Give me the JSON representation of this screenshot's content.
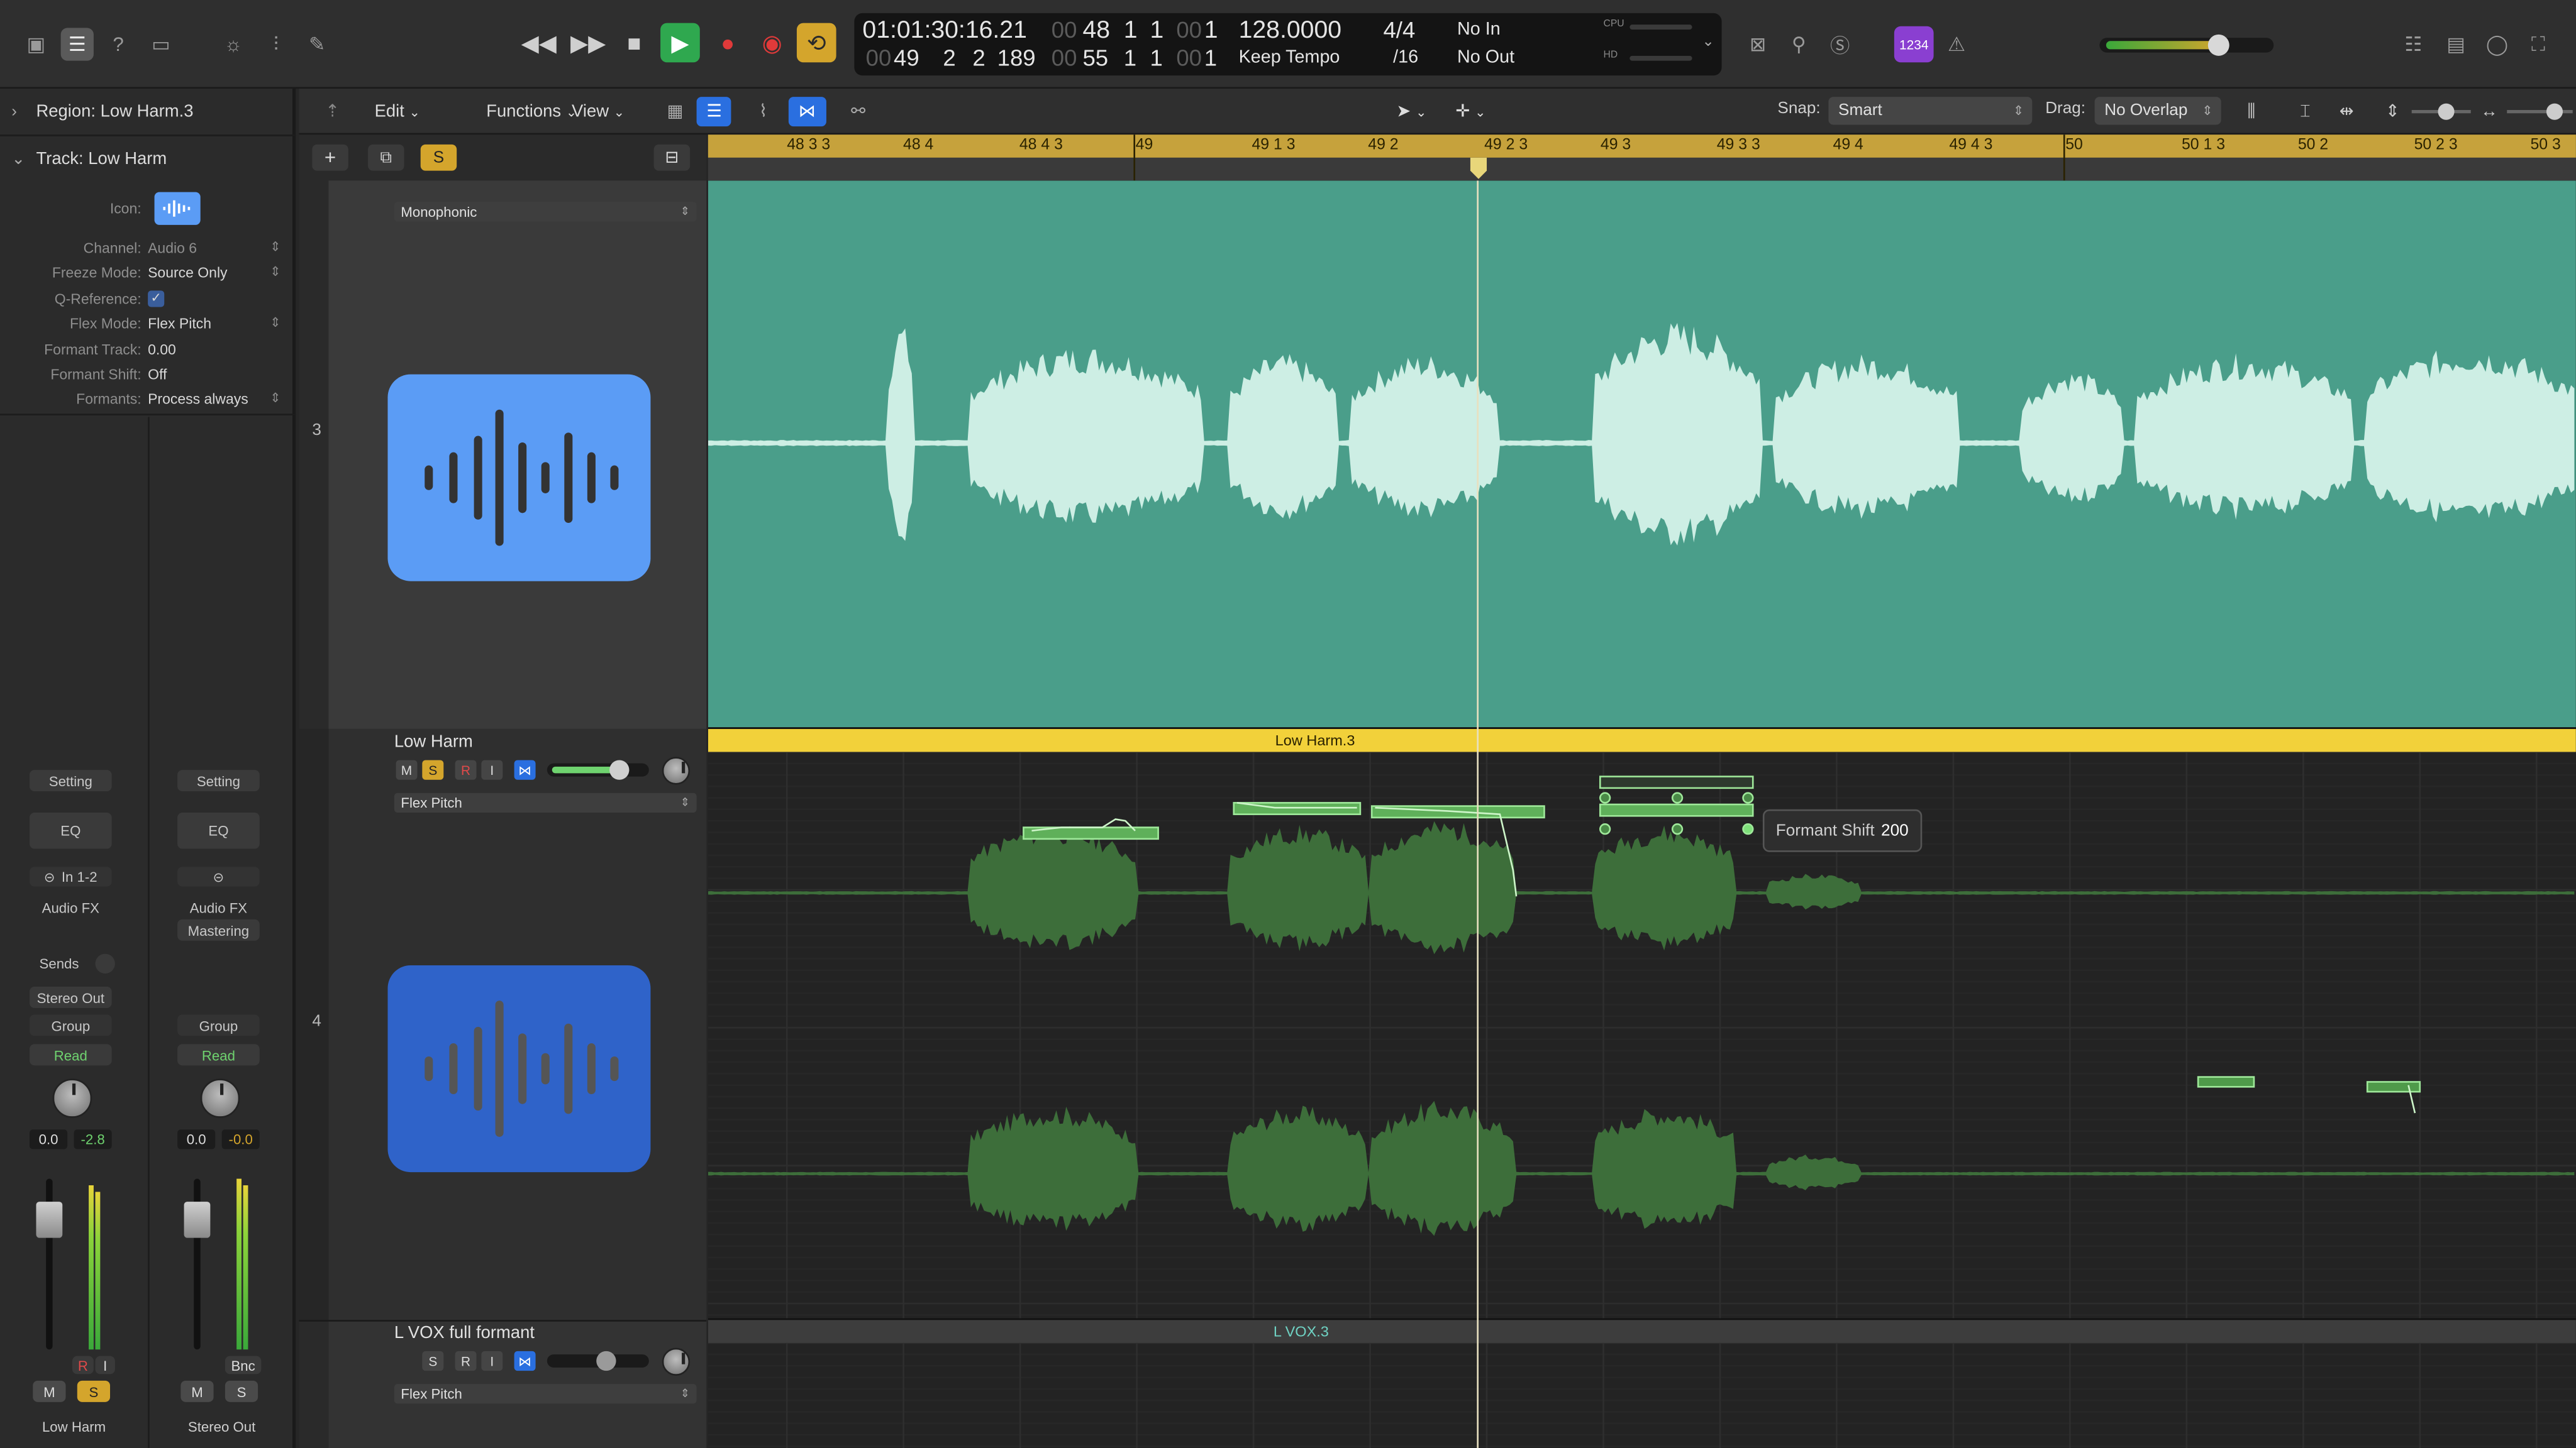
{
  "transport": {
    "time": "01:01:30:16.21",
    "time_dim": "00",
    "bars_top": [
      "48",
      "1",
      "1"
    ],
    "bars_top_dim": "00",
    "bars_top_tick": "1",
    "bars_bottom": [
      "49",
      "2",
      "2",
      "189"
    ],
    "bars_bottom_dim": "00",
    "bars_bottom2": [
      "55",
      "1",
      "1"
    ],
    "bars_bottom2_tick": "1",
    "tempo": "128.0000",
    "tempo_mode": "Keep Tempo",
    "signature": "4/4",
    "division": "/16",
    "in": "No In",
    "out": "No Out",
    "cpu_label": "CPU",
    "hd_label": "HD",
    "badge": "1234"
  },
  "inspector": {
    "region_label": "Region:",
    "region_name": "Low Harm.3",
    "track_label": "Track:",
    "track_name": "Low Harm",
    "icon_label": "Icon:",
    "rows": [
      {
        "label": "Channel:",
        "value": "Audio 6"
      },
      {
        "label": "Freeze Mode:",
        "value": "Source Only"
      },
      {
        "label": "Q-Reference:",
        "value": "✓"
      },
      {
        "label": "Flex Mode:",
        "value": "Flex Pitch"
      },
      {
        "label": "Formant Track:",
        "value": "0.00"
      },
      {
        "label": "Formant Shift:",
        "value": "Off"
      },
      {
        "label": "Formants:",
        "value": "Process always"
      }
    ]
  },
  "strips": [
    {
      "setting": "Setting",
      "eq": "EQ",
      "input": "In 1-2",
      "audiofx": "Audio FX",
      "fx2": "",
      "sends": "Sends",
      "output": "Stereo Out",
      "group": "Group",
      "auto": "Read",
      "vol": "0.0",
      "peak": "-2.8",
      "btn_r": "R",
      "btn_i": "I",
      "m": "M",
      "s": "S",
      "name": "Low Harm"
    },
    {
      "setting": "Setting",
      "eq": "EQ",
      "input": "",
      "audiofx": "Audio FX",
      "fx2": "Mastering",
      "sends": "",
      "output": "",
      "group": "Group",
      "auto": "Read",
      "vol": "0.0",
      "peak": "-0.0",
      "btn_r": "Bnc",
      "btn_i": "",
      "m": "M",
      "s": "S",
      "name": "Stereo Out"
    }
  ],
  "toolbar": {
    "edit": "Edit",
    "functions": "Functions",
    "view": "View",
    "snap_label": "Snap:",
    "snap_value": "Smart",
    "drag_label": "Drag:",
    "drag_value": "No Overlap"
  },
  "ruler": {
    "labels": [
      "48 3 3",
      "48 4",
      "48 4 3",
      "49",
      "49 1 3",
      "49 2",
      "49 2 3",
      "49 3",
      "49 3 3",
      "49 4",
      "49 4 3",
      "50",
      "50 1 3",
      "50 2",
      "50 2 3",
      "50 3"
    ]
  },
  "tracks": [
    {
      "number": "3",
      "name": "",
      "mode": "Monophonic"
    },
    {
      "number": "4",
      "name": "Low Harm",
      "mode": "Flex Pitch",
      "region": "Low Harm.3"
    },
    {
      "number": "",
      "name": "L VOX full formant",
      "mode": "Flex Pitch",
      "region": "L VOX.3"
    }
  ],
  "tooltip": {
    "label": "Formant Shift",
    "value": "200"
  },
  "colors": {
    "accent_yellow": "#d4a52c",
    "play_green": "#2fa84f",
    "audio_teal": "#4a9e8a",
    "flex_green": "#7ee07a",
    "icon_blue": "#5b9cf5"
  }
}
